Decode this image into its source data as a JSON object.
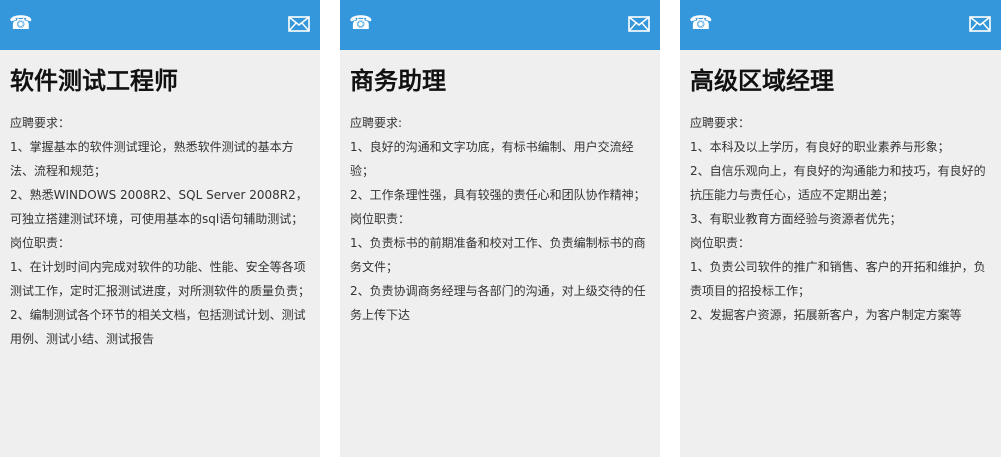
{
  "cards": [
    {
      "title": "软件测试工程师",
      "lines": [
        "应聘要求：",
        "1、掌握基本的软件测试理论，熟悉软件测试的基本方法、流程和规范；",
        "2、熟悉WINDOWS 2008R2、SQL Server 2008R2，可独立搭建测试环境，可使用基本的sql语句辅助测试；",
        "岗位职责：",
        "1、在计划时间内完成对软件的功能、性能、安全等各项测试工作，定时汇报测试进度，对所测软件的质量负责；",
        "2、编制测试各个环节的相关文档，包括测试计划、测试用例、测试小结、测试报告"
      ]
    },
    {
      "title": "商务助理",
      "lines": [
        "应聘要求:",
        "1、良好的沟通和文字功底，有标书编制、用户交流经验；",
        "2、工作条理性强，具有较强的责任心和团队协作精神；",
        "岗位职责：",
        "1、负责标书的前期准备和校对工作、负责编制标书的商务文件；",
        "2、负责协调商务经理与各部门的沟通，对上级交待的任务上传下达"
      ]
    },
    {
      "title": "高级区域经理",
      "lines": [
        "应聘要求：",
        "1、本科及以上学历，有良好的职业素养与形象；",
        "2、自信乐观向上，有良好的沟通能力和技巧，有良好的抗压能力与责任心，适应不定期出差；",
        "3、有职业教育方面经验与资源者优先；",
        "岗位职责：",
        "1、负责公司软件的推广和销售、客户的开拓和维护，负责项目的招投标工作；",
        "2、发掘客户资源，拓展新客户，为客户制定方案等"
      ]
    }
  ],
  "icons": {
    "phone": "☎",
    "mail": "mail-icon"
  },
  "colors": {
    "header": "#3497db",
    "card_bg": "#efefef",
    "title": "#111111",
    "text": "#333333"
  }
}
